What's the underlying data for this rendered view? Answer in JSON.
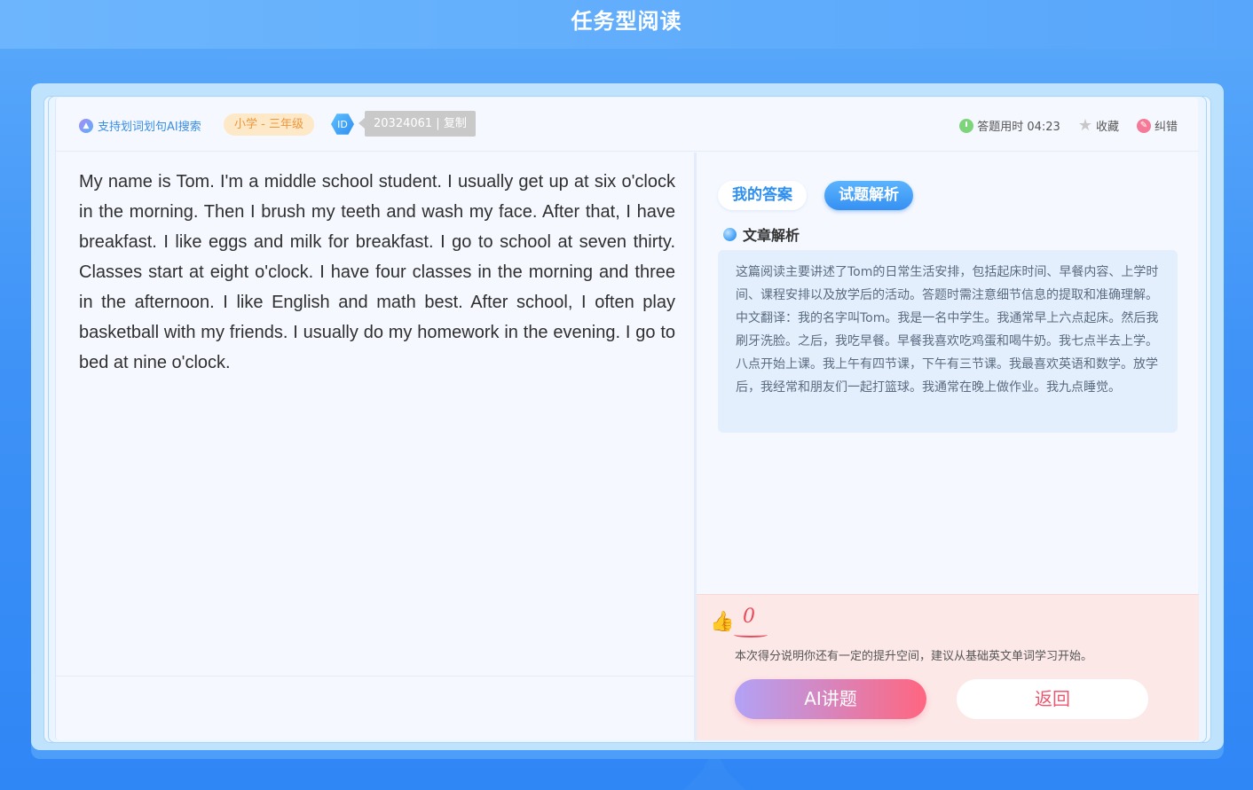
{
  "page": {
    "title": "任务型阅读"
  },
  "header": {
    "ai_search_label": "支持划词划句AI搜索",
    "grade": "小学 - 三年级",
    "id_label": "ID",
    "id_tag": "20324061 | 复制",
    "time_label": "答题用时 04:23",
    "favorite_label": "收藏",
    "report_label": "纠错"
  },
  "passage": {
    "text": "My name is Tom. I'm a middle school student. I usually get up at six o'clock in the morning. Then I brush my teeth and wash my face. After that, I have breakfast. I like eggs and milk for breakfast. I go to school at seven thirty. Classes start at eight o'clock. I have four classes in the morning and three in the afternoon. I like English and math best. After school, I often play basketball with my friends. I usually do my homework in the evening. I go to bed at nine o'clock."
  },
  "tabs": [
    {
      "label": "我的答案",
      "active": false
    },
    {
      "label": "试题解析",
      "active": true
    }
  ],
  "analysis": {
    "title": "文章解析",
    "text": "这篇阅读主要讲述了Tom的日常生活安排，包括起床时间、早餐内容、上学时间、课程安排以及放学后的活动。答题时需注意细节信息的提取和准确理解。中文翻译：我的名字叫Tom。我是一名中学生。我通常早上六点起床。然后我刷牙洗脸。之后，我吃早餐。早餐我喜欢吃鸡蛋和喝牛奶。我七点半去上学。八点开始上课。我上午有四节课，下午有三节课。我最喜欢英语和数学。放学后，我经常和朋友们一起打篮球。我通常在晚上做作业。我九点睡觉。"
  },
  "score": {
    "value": "0",
    "message": "本次得分说明你还有一定的提升空间，建议从基础英文单词学习开始。",
    "ai_button": "AI讲题",
    "back_button": "返回"
  },
  "colors": {
    "accent": "#3590f3",
    "score": "#e94b5b",
    "grade_badge": "#f0963a"
  }
}
